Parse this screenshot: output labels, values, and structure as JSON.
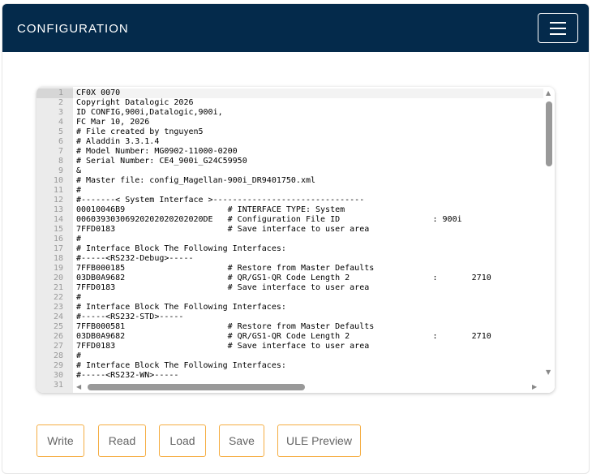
{
  "header": {
    "title": "CONFIGURATION",
    "menu_icon": "hamburger-icon"
  },
  "editor": {
    "lines": [
      "CF0X 0070",
      "Copyright Datalogic 2026",
      "ID CONFIG,900i,Datalogic,900i,",
      "FC Mar 10, 2026",
      "# File created by tnguyen5",
      "# Aladdin 3.3.1.4",
      "# Model Number: MG0902-11000-0200",
      "# Serial Number: CE4_900i_G24C59950",
      "&",
      "# Master file: config_Magellan-900i_DR9401750.xml",
      "#",
      "#-------< System Interface >-------------------------------",
      "00010046B9                     # INTERFACE TYPE: System",
      "00603930306920202020202020DE   # Configuration File ID                   : 900i",
      "7FFD0183                       # Save interface to user area",
      "#",
      "# Interface Block The Following Interfaces:",
      "#-----<RS232-Debug>-----",
      "7FFB000185                     # Restore from Master Defaults",
      "03DB0A9682                     # QR/GS1-QR Code Length 2                 :       2710",
      "7FFD0183                       # Save interface to user area",
      "#",
      "# Interface Block The Following Interfaces:",
      "#-----<RS232-STD>-----",
      "7FFB000581                     # Restore from Master Defaults",
      "03DB0A9682                     # QR/GS1-QR Code Length 2                 :       2710",
      "7FFD0183                       # Save interface to user area",
      "#",
      "# Interface Block The Following Interfaces:",
      "#-----<RS232-WN>-----",
      ""
    ]
  },
  "buttons": {
    "write": "Write",
    "read": "Read",
    "load": "Load",
    "save": "Save",
    "ule_preview": "ULE Preview"
  }
}
